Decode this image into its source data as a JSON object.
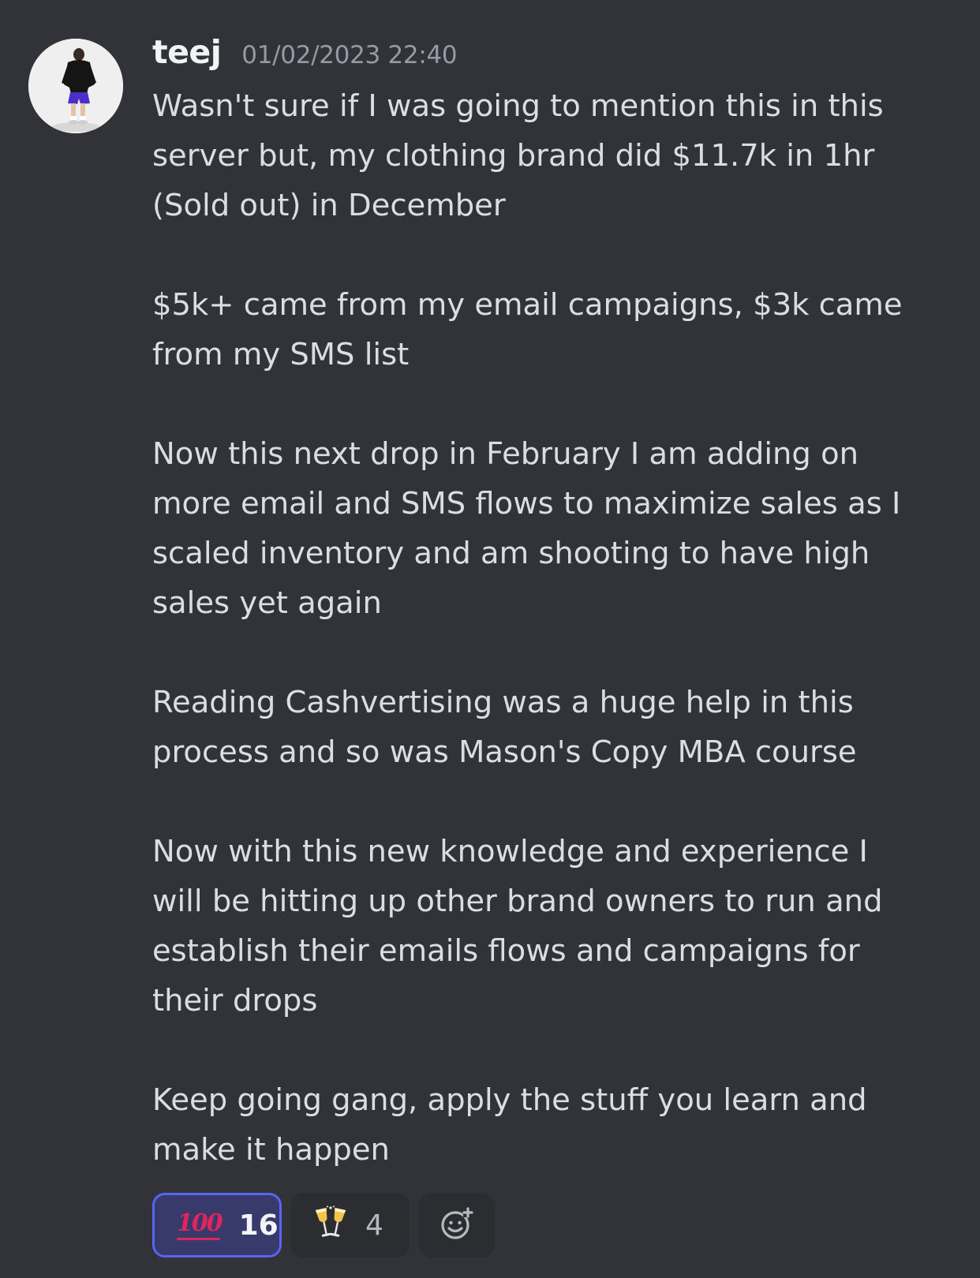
{
  "message": {
    "author": "teej",
    "timestamp": "01/02/2023 22:40",
    "paragraphs": [
      [
        "Wasn't sure if I was going to mention this in this",
        "server but, my clothing brand did $11.7k in 1hr",
        "(Sold out) in December"
      ],
      [
        "$5k+ came from my email campaigns, $3k came",
        "from my SMS list"
      ],
      [
        "Now this next drop in February I am adding on",
        "more email and SMS flows to maximize sales as I",
        "scaled inventory and am shooting to have high",
        "sales yet again"
      ],
      [
        "Reading Cashvertising was a huge help in this",
        "process and so was Mason's Copy MBA course"
      ],
      [
        "Now with this new knowledge and experience I",
        "will be hitting up other brand owners to run and",
        "establish their emails flows and campaigns for",
        "their drops"
      ],
      [
        "Keep going gang, apply the stuff you learn and",
        "make it happen"
      ]
    ]
  },
  "reactions": [
    {
      "emoji": "100",
      "icon": "hundred-points-emoji",
      "count": "16",
      "active": true
    },
    {
      "emoji": "🥂",
      "icon": "clinking-glasses-emoji",
      "count": "4",
      "active": false
    }
  ],
  "add_reaction": {
    "icon": "add-reaction-icon"
  },
  "colors": {
    "background": "#313338",
    "text": "#dbdee1",
    "timestamp": "#949ba4",
    "active_reaction_border": "#5865f2",
    "active_reaction_bg": "#373a6b"
  }
}
